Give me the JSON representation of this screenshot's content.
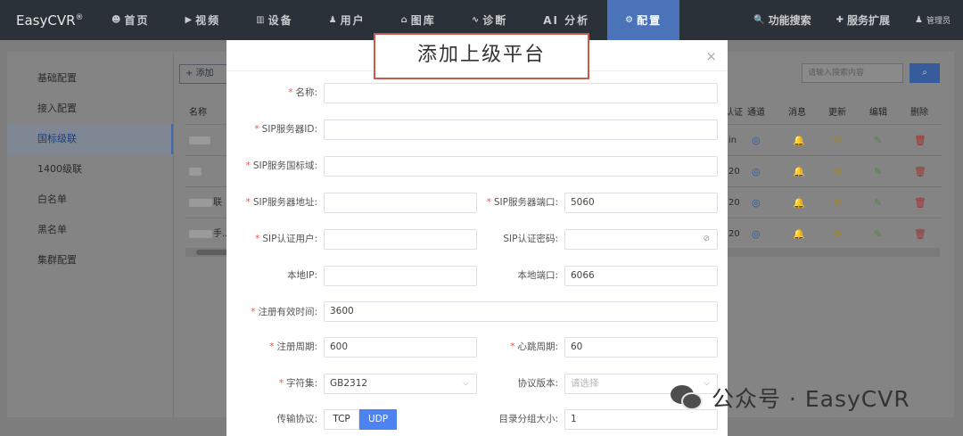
{
  "nav": {
    "logo": "EasyCVR",
    "logo_mark": "®",
    "items": [
      {
        "icon": "☻",
        "label": "首页"
      },
      {
        "icon": "▶",
        "label": "视频"
      },
      {
        "icon": "▥",
        "label": "设备"
      },
      {
        "icon": "♟",
        "label": "用户"
      },
      {
        "icon": "⌂",
        "label": "图库"
      },
      {
        "icon": "∿",
        "label": "诊断"
      },
      {
        "icon": "",
        "label": "AI 分析"
      },
      {
        "icon": "⚙",
        "label": "配置"
      }
    ],
    "right": [
      {
        "icon": "🔍",
        "label": "功能搜索"
      },
      {
        "icon": "✚",
        "label": "服务扩展"
      },
      {
        "icon": "♟",
        "label": "管理员"
      }
    ],
    "accent": "#4a73b9"
  },
  "sidebar": {
    "items": [
      {
        "label": "基础配置"
      },
      {
        "label": "接入配置"
      },
      {
        "label": "国标级联"
      },
      {
        "label": "1400级联"
      },
      {
        "label": "白名单"
      },
      {
        "label": "黑名单"
      },
      {
        "label": "集群配置"
      }
    ]
  },
  "background": {
    "add_label": "添加",
    "search_placeholder": "请输入搜索内容",
    "columns": [
      "名称",
      "认证",
      "通道",
      "消息",
      "更新",
      "编辑",
      "删除"
    ],
    "rows": [
      {
        "name": "",
        "auth": "in"
      },
      {
        "name": "",
        "auth": "20"
      },
      {
        "name": "联",
        "auth": "20"
      },
      {
        "name": "手...",
        "auth": "20"
      }
    ]
  },
  "modal": {
    "title": "添加上级平台",
    "close": "×",
    "fields": {
      "name": {
        "label": "名称:",
        "value": ""
      },
      "sip_id": {
        "label": "SIP服务器ID:",
        "value": ""
      },
      "sip_domain": {
        "label": "SIP服务国标域:",
        "value": ""
      },
      "sip_addr": {
        "label": "SIP服务器地址:",
        "value": ""
      },
      "sip_port": {
        "label": "SIP服务器端口:",
        "value": "5060"
      },
      "sip_user": {
        "label": "SIP认证用户:",
        "value": ""
      },
      "sip_pwd": {
        "label": "SIP认证密码:",
        "value": ""
      },
      "local_ip": {
        "label": "本地IP:",
        "value": ""
      },
      "local_port": {
        "label": "本地端口:",
        "value": "6066"
      },
      "reg_valid": {
        "label": "注册有效时间:",
        "value": "3600"
      },
      "reg_period": {
        "label": "注册周期:",
        "value": "600"
      },
      "heartbeat": {
        "label": "心跳周期:",
        "value": "60"
      },
      "charset": {
        "label": "字符集:",
        "value": "GB2312"
      },
      "protocol_ver": {
        "label": "协议版本:",
        "placeholder": "请选择"
      },
      "transport": {
        "label": "传输协议:",
        "options": [
          "TCP",
          "UDP"
        ],
        "selected": "UDP"
      },
      "catalog_size": {
        "label": "目录分组大小:",
        "value": "1"
      }
    }
  },
  "watermark": {
    "text": "公众号 · EasyCVR"
  }
}
